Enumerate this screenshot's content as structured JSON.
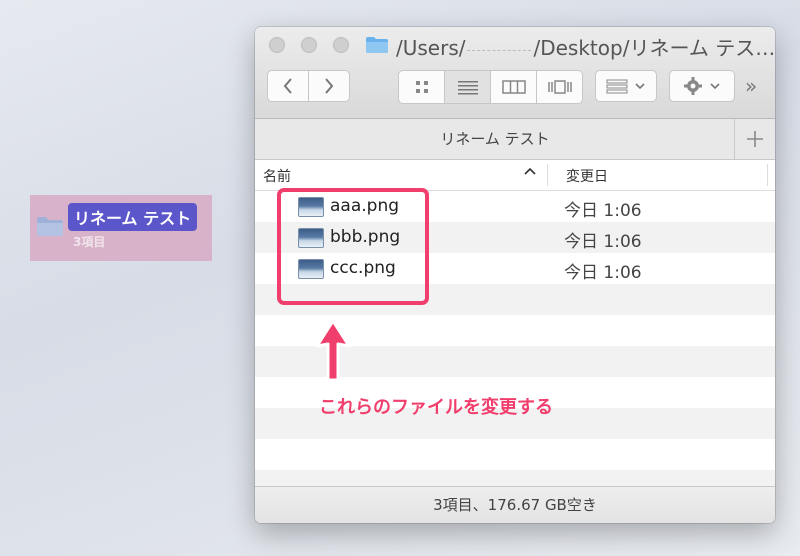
{
  "desktop": {
    "folder_name": "リネーム テスト",
    "item_count": "3項目"
  },
  "window": {
    "path_prefix": "/Users/",
    "path_suffix": "/Desktop/リネーム テス…",
    "tab_title": "リネーム テスト",
    "columns": {
      "name": "名前",
      "date": "変更日"
    },
    "files": [
      {
        "name": "aaa.png",
        "modified": "今日 1:06"
      },
      {
        "name": "bbb.png",
        "modified": "今日 1:06"
      },
      {
        "name": "ccc.png",
        "modified": "今日 1:06"
      }
    ],
    "status": "3項目、176.67 GB空き",
    "overflow_label": "»"
  },
  "annotation": {
    "text": "これらのファイルを変更する",
    "color": "#f03f6d"
  }
}
